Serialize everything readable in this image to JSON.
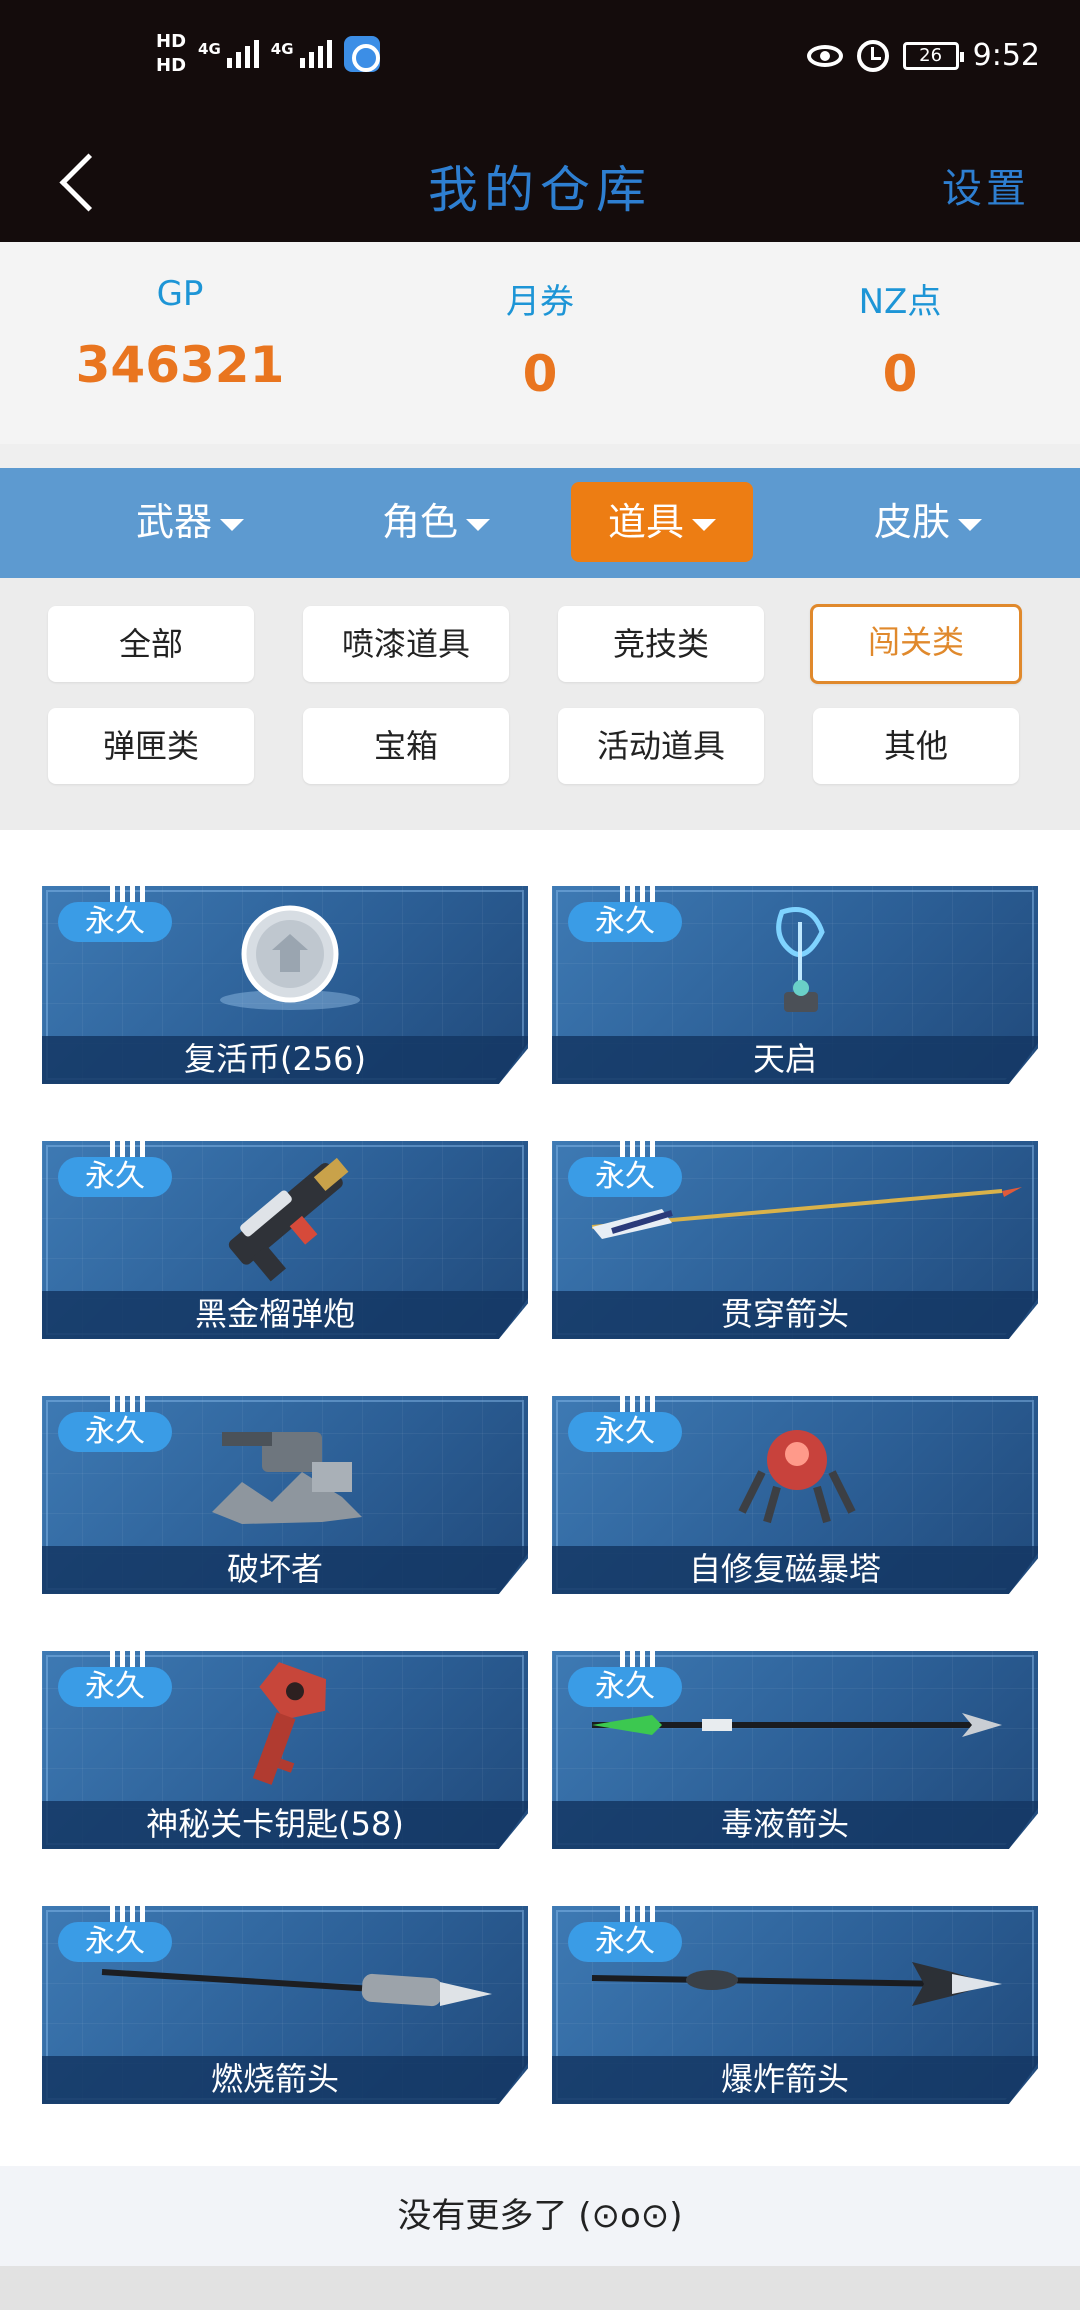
{
  "status_bar": {
    "time": "9:52",
    "battery": "26",
    "hd1": "HD",
    "hd2": "HD",
    "net": "4G"
  },
  "nav": {
    "title": "我的仓库",
    "settings": "设置"
  },
  "currency": [
    {
      "label": "GP",
      "value": "346321"
    },
    {
      "label": "月券",
      "value": "0"
    },
    {
      "label": "NZ点",
      "value": "0"
    }
  ],
  "tabs": [
    {
      "label": "武器",
      "active": false
    },
    {
      "label": "角色",
      "active": false
    },
    {
      "label": "道具",
      "active": true
    },
    {
      "label": "皮肤",
      "active": false
    }
  ],
  "filters": [
    {
      "label": "全部",
      "selected": false
    },
    {
      "label": "喷漆道具",
      "selected": false
    },
    {
      "label": "竞技类",
      "selected": false
    },
    {
      "label": "闯关类",
      "selected": true
    },
    {
      "label": "弹匣类",
      "selected": false
    },
    {
      "label": "宝箱",
      "selected": false
    },
    {
      "label": "活动道具",
      "selected": false
    },
    {
      "label": "其他",
      "selected": false
    }
  ],
  "items": [
    {
      "badge": "永久",
      "name": "复活币(256)",
      "icon": "coin-icon"
    },
    {
      "badge": "永久",
      "name": "天启",
      "icon": "device-icon"
    },
    {
      "badge": "永久",
      "name": "黑金榴弹炮",
      "icon": "launcher-icon"
    },
    {
      "badge": "永久",
      "name": "贯穿箭头",
      "icon": "arrow-icon"
    },
    {
      "badge": "永久",
      "name": "破坏者",
      "icon": "turret-icon"
    },
    {
      "badge": "永久",
      "name": "自修复磁暴塔",
      "icon": "tower-icon"
    },
    {
      "badge": "永久",
      "name": "神秘关卡钥匙(58)",
      "icon": "key-icon"
    },
    {
      "badge": "永久",
      "name": "毒液箭头",
      "icon": "arrow-icon"
    },
    {
      "badge": "永久",
      "name": "燃烧箭头",
      "icon": "arrow-icon"
    },
    {
      "badge": "永久",
      "name": "爆炸箭头",
      "icon": "arrow-icon"
    }
  ],
  "footer": {
    "text": "没有更多了 (⊙o⊙)"
  },
  "colors": {
    "accent": "#ed7d13",
    "tabbar": "#5d9ad0",
    "title": "#2e7fd1",
    "value": "#e9751f"
  }
}
